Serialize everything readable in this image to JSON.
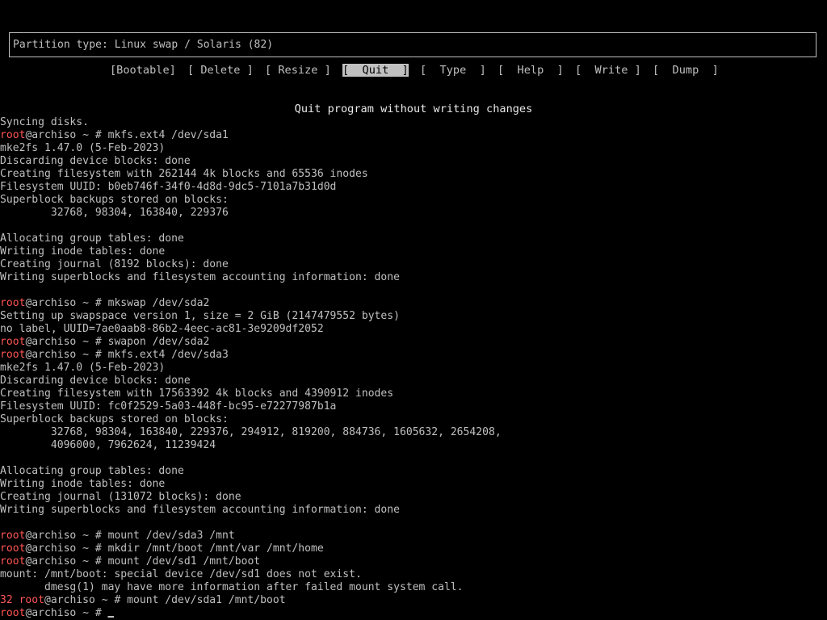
{
  "partition_box": {
    "text": "Partition type: Linux swap / Solaris (82)"
  },
  "menu": {
    "items": [
      {
        "label": "[Bootable]",
        "selected": false
      },
      {
        "label": "[ Delete ]",
        "selected": false
      },
      {
        "label": "[ Resize ]",
        "selected": false
      },
      {
        "label": "[  Quit  ]",
        "selected": true
      },
      {
        "label": "[  Type  ]",
        "selected": false
      },
      {
        "label": "[  Help  ]",
        "selected": false
      },
      {
        "label": "[  Write ]",
        "selected": false
      },
      {
        "label": "[  Dump  ]",
        "selected": false
      }
    ],
    "help_text": "Quit program without writing changes"
  },
  "prompt": {
    "user": "root",
    "host_path": "@archiso ~ # "
  },
  "terminal": {
    "lines": [
      {
        "text": "Syncing disks."
      },
      {
        "prompt": true,
        "cmd": "mkfs.ext4 /dev/sda1"
      },
      {
        "text": "mke2fs 1.47.0 (5-Feb-2023)"
      },
      {
        "text": "Discarding device blocks: done"
      },
      {
        "text": "Creating filesystem with 262144 4k blocks and 65536 inodes"
      },
      {
        "text": "Filesystem UUID: b0eb746f-34f0-4d8d-9dc5-7101a7b31d0d"
      },
      {
        "text": "Superblock backups stored on blocks:"
      },
      {
        "text": "        32768, 98304, 163840, 229376"
      },
      {
        "text": ""
      },
      {
        "text": "Allocating group tables: done"
      },
      {
        "text": "Writing inode tables: done"
      },
      {
        "text": "Creating journal (8192 blocks): done"
      },
      {
        "text": "Writing superblocks and filesystem accounting information: done"
      },
      {
        "text": ""
      },
      {
        "prompt": true,
        "cmd": "mkswap /dev/sda2"
      },
      {
        "text": "Setting up swapspace version 1, size = 2 GiB (2147479552 bytes)"
      },
      {
        "text": "no label, UUID=7ae0aab8-86b2-4eec-ac81-3e9209df2052"
      },
      {
        "prompt": true,
        "cmd": "swapon /dev/sda2"
      },
      {
        "prompt": true,
        "cmd": "mkfs.ext4 /dev/sda3"
      },
      {
        "text": "mke2fs 1.47.0 (5-Feb-2023)"
      },
      {
        "text": "Discarding device blocks: done"
      },
      {
        "text": "Creating filesystem with 17563392 4k blocks and 4390912 inodes"
      },
      {
        "text": "Filesystem UUID: fc0f2529-5a03-448f-bc95-e72277987b1a"
      },
      {
        "text": "Superblock backups stored on blocks:"
      },
      {
        "text": "        32768, 98304, 163840, 229376, 294912, 819200, 884736, 1605632, 2654208,"
      },
      {
        "text": "        4096000, 7962624, 11239424"
      },
      {
        "text": ""
      },
      {
        "text": "Allocating group tables: done"
      },
      {
        "text": "Writing inode tables: done"
      },
      {
        "text": "Creating journal (131072 blocks): done"
      },
      {
        "text": "Writing superblocks and filesystem accounting information: done"
      },
      {
        "text": ""
      },
      {
        "prompt": true,
        "cmd": "mount /dev/sda3 /mnt"
      },
      {
        "prompt": true,
        "cmd": "mkdir /mnt/boot /mnt/var /mnt/home"
      },
      {
        "prompt": true,
        "cmd": "mount /dev/sd1 /mnt/boot"
      },
      {
        "text": "mount: /mnt/boot: special device /dev/sd1 does not exist."
      },
      {
        "text": "       dmesg(1) may have more information after failed mount system call."
      },
      {
        "prompt": true,
        "exit": "32",
        "cmd": "mount /dev/sda1 /mnt/boot"
      },
      {
        "prompt": true,
        "cmd": "",
        "cursor": true
      }
    ]
  },
  "colors": {
    "background": "#000000",
    "foreground": "#c0c0c0",
    "prompt_user": "#ff5555",
    "highlight_bg": "#c0c0c0",
    "highlight_fg": "#000000"
  }
}
